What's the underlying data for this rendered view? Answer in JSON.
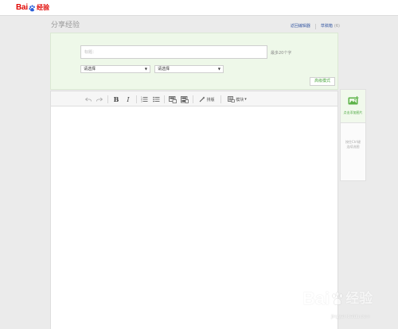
{
  "header": {
    "logo_bai": "Bai",
    "logo_jingyan": "经验"
  },
  "page": {
    "title": "分享经验"
  },
  "top_links": {
    "old_editor": "返回编辑器",
    "drafts": "草稿箱",
    "drafts_count": "(6)"
  },
  "form": {
    "title_placeholder": "标题：",
    "title_value": "",
    "title_hint": "最多20个字",
    "category1_selected": "请选择",
    "category2_selected": "请选择",
    "advanced_mode": "高级模式"
  },
  "toolbar": {
    "icons": [
      "undo-icon",
      "redo-icon",
      "bold-icon",
      "italic-icon",
      "ordered-list-icon",
      "unordered-list-icon",
      "insert-image-icon",
      "insert-video-icon",
      "format-brush-icon",
      "module-icon"
    ],
    "bold_label": "B",
    "italic_label": "I",
    "format_label": "排版",
    "module_label": "模块",
    "module_arrow": "▾"
  },
  "side_panel": {
    "add_image_label": "点击添加图片",
    "tip_line1": "按住Ctrl键",
    "tip_line2": "连续选图"
  },
  "watermark": {
    "bai": "Bai",
    "jingyan": "经验",
    "url": "jingyan.baidu.com"
  },
  "colors": {
    "brand_red": "#e10602",
    "accent_green": "#4aa63e",
    "link_blue": "#3e5fa6",
    "panel_green": "#eef8e9"
  }
}
